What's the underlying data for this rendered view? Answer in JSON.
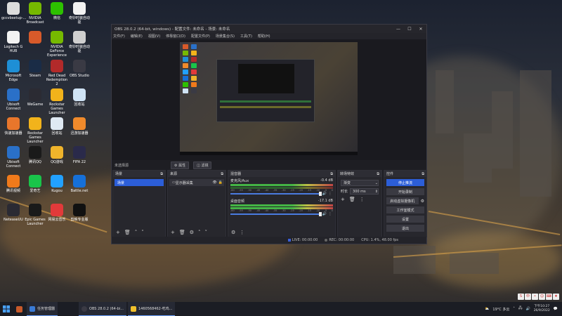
{
  "desktop": {
    "icons": [
      {
        "label": "gccvbsetup-...",
        "color": "#dcdcdc"
      },
      {
        "label": "NVIDIA Broadcast",
        "color": "#76b900"
      },
      {
        "label": "微信",
        "color": "#2dc100"
      },
      {
        "label": "奇妙时装自动驱",
        "color": "#f2f2f2"
      },
      {
        "label": "Logitech G HUB",
        "color": "#f2f2f2"
      },
      {
        "label": "",
        "color": "#d85a2a"
      },
      {
        "label": "NVIDIA GeForce Experience",
        "color": "#76b900"
      },
      {
        "label": "奇妙时装自动驱",
        "color": "#cfcfcf"
      },
      {
        "label": "Microsoft Edge",
        "color": "#1e8fd6"
      },
      {
        "label": "Steam",
        "color": "#1a2c46"
      },
      {
        "label": "Red Dead Redemption 2",
        "color": "#b22a2a"
      },
      {
        "label": "OBS Studio",
        "color": "#3a3a44"
      },
      {
        "label": "Ubisoft Connect",
        "color": "#2a70c8"
      },
      {
        "label": "WeGame",
        "color": "#2b2b33"
      },
      {
        "label": "Rockstar Games Launcher",
        "color": "#f2b31b"
      },
      {
        "label": "回收站",
        "color": "#cfe3f5"
      },
      {
        "label": "快速加速器",
        "color": "#e8762b"
      },
      {
        "label": "Rockstar Games Launcher",
        "color": "#f2b31b"
      },
      {
        "label": "回收站",
        "color": "#dfe9f3"
      },
      {
        "label": "迅游加速器",
        "color": "#f08a2b"
      },
      {
        "label": "Ubisoft Connect",
        "color": "#2a70c8"
      },
      {
        "label": "腾讯QQ",
        "color": "#1a1a1a"
      },
      {
        "label": "QQ游戏",
        "color": "#f0b42b"
      },
      {
        "label": "FIFA 22",
        "color": "#2a2a4a"
      },
      {
        "label": "腾讯视频",
        "color": "#f07a1b"
      },
      {
        "label": "爱奇艺",
        "color": "#19c44a"
      },
      {
        "label": "Kugou",
        "color": "#22a1ff"
      },
      {
        "label": "Battle.net",
        "color": "#1670d8"
      },
      {
        "label": "NeteaseUU",
        "color": "#2a2a33"
      },
      {
        "label": "Epic Games Launcher",
        "color": "#1a1a1a"
      },
      {
        "label": "网易云音乐",
        "color": "#e23a3a"
      },
      {
        "label": "剪映专业版",
        "color": "#111111"
      }
    ]
  },
  "obs": {
    "title": "OBS 28.0.2 (64-bit, windows) - 配置文件: 未命名 - 场景: 未命名",
    "window_buttons": [
      "—",
      "☐",
      "✕"
    ],
    "menu": [
      "文件(F)",
      "编辑(E)",
      "视图(V)",
      "停靠窗口(D)",
      "配置文件(P)",
      "场景集合(S)",
      "工具(T)",
      "帮助(H)"
    ],
    "no_source": "未选择源",
    "props_btn": "属性",
    "filters_btn": "滤镜",
    "docks": {
      "scenes": {
        "title": "场景",
        "items": [
          "场景"
        ]
      },
      "sources": {
        "title": "来源",
        "items": [
          "显示器采集"
        ]
      },
      "mixer": {
        "title": "混音器",
        "channels": [
          {
            "name": "麦克风/Aux",
            "db": "-0.4 dB"
          },
          {
            "name": "桌面音频",
            "db": "-17.1 dB"
          }
        ],
        "ticks": [
          "-60",
          "-55",
          "-50",
          "-45",
          "-40",
          "-35",
          "-30",
          "-25",
          "-20",
          "-15",
          "-10",
          "-5",
          "0"
        ]
      },
      "transitions": {
        "title": "转场特效",
        "type": "渐变",
        "duration_label": "时长",
        "duration": "300 ms"
      },
      "controls": {
        "title": "控件",
        "buttons": [
          "停止推流",
          "开始录制",
          "启动虚拟摄像机",
          "工作室模式",
          "设置",
          "退出"
        ]
      }
    },
    "status": {
      "live": "LIVE: 00:00:00",
      "rec": "REC: 00:00:00",
      "cpu": "CPU: 1.4%, 48.00 fps"
    }
  },
  "taskbar": {
    "apps": [
      {
        "label": "任务管理器",
        "color": "#3a7bd5"
      },
      {
        "label": "OBS 28.0.2 (64-bi...",
        "color": "#3a3a44"
      },
      {
        "label": "1460568462-吃鸡...",
        "color": "#f0c02b"
      }
    ],
    "weather": "19°C 多云",
    "time": "下午10:27",
    "date": "26/9/2022",
    "ime": [
      "S",
      "中",
      "•",
      "☺",
      "⌨",
      "♦"
    ]
  }
}
